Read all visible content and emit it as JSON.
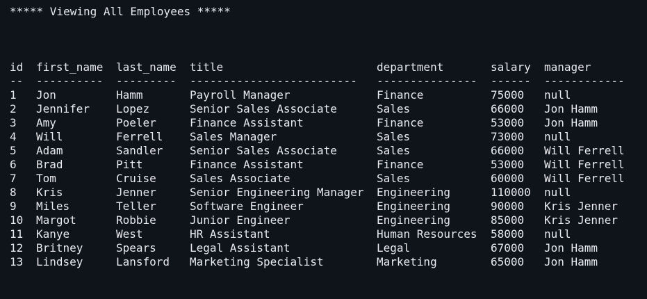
{
  "heading": "***** Viewing All Employees *****",
  "columns": {
    "id": "id",
    "first_name": "first_name",
    "last_name": "last_name",
    "title": "title",
    "department": "department",
    "salary": "salary",
    "manager": "manager"
  },
  "dashes": {
    "id": "--",
    "first_name": "----------",
    "last_name": "---------",
    "title": "-------------------------",
    "department": "---------------",
    "salary": "------",
    "manager": "------------"
  },
  "rows": [
    {
      "id": "1",
      "first_name": "Jon",
      "last_name": "Hamm",
      "title": "Payroll Manager",
      "department": "Finance",
      "salary": "75000",
      "manager": "null"
    },
    {
      "id": "2",
      "first_name": "Jennifer",
      "last_name": "Lopez",
      "title": "Senior Sales Associate",
      "department": "Sales",
      "salary": "66000",
      "manager": "Jon Hamm"
    },
    {
      "id": "3",
      "first_name": "Amy",
      "last_name": "Poeler",
      "title": "Finance Assistant",
      "department": "Finance",
      "salary": "53000",
      "manager": "Jon Hamm"
    },
    {
      "id": "4",
      "first_name": "Will",
      "last_name": "Ferrell",
      "title": "Sales Manager",
      "department": "Sales",
      "salary": "73000",
      "manager": "null"
    },
    {
      "id": "5",
      "first_name": "Adam",
      "last_name": "Sandler",
      "title": "Senior Sales Associate",
      "department": "Sales",
      "salary": "66000",
      "manager": "Will Ferrell"
    },
    {
      "id": "6",
      "first_name": "Brad",
      "last_name": "Pitt",
      "title": "Finance Assistant",
      "department": "Finance",
      "salary": "53000",
      "manager": "Will Ferrell"
    },
    {
      "id": "7",
      "first_name": "Tom",
      "last_name": "Cruise",
      "title": "Sales Associate",
      "department": "Sales",
      "salary": "60000",
      "manager": "Will Ferrell"
    },
    {
      "id": "8",
      "first_name": "Kris",
      "last_name": "Jenner",
      "title": "Senior Engineering Manager",
      "department": "Engineering",
      "salary": "110000",
      "manager": "null"
    },
    {
      "id": "9",
      "first_name": "Miles",
      "last_name": "Teller",
      "title": "Software Engineer",
      "department": "Engineering",
      "salary": "90000",
      "manager": "Kris Jenner"
    },
    {
      "id": "10",
      "first_name": "Margot",
      "last_name": "Robbie",
      "title": "Junior Engineer",
      "department": "Engineering",
      "salary": "85000",
      "manager": "Kris Jenner"
    },
    {
      "id": "11",
      "first_name": "Kanye",
      "last_name": "West",
      "title": "HR Assistant",
      "department": "Human Resources",
      "salary": "58000",
      "manager": "null"
    },
    {
      "id": "12",
      "first_name": "Britney",
      "last_name": "Spears",
      "title": "Legal Assistant",
      "department": "Legal",
      "salary": "67000",
      "manager": "Jon Hamm"
    },
    {
      "id": "13",
      "first_name": "Lindsey",
      "last_name": "Lansford",
      "title": "Marketing Specialist",
      "department": "Marketing",
      "salary": "65000",
      "manager": "Jon Hamm"
    }
  ]
}
